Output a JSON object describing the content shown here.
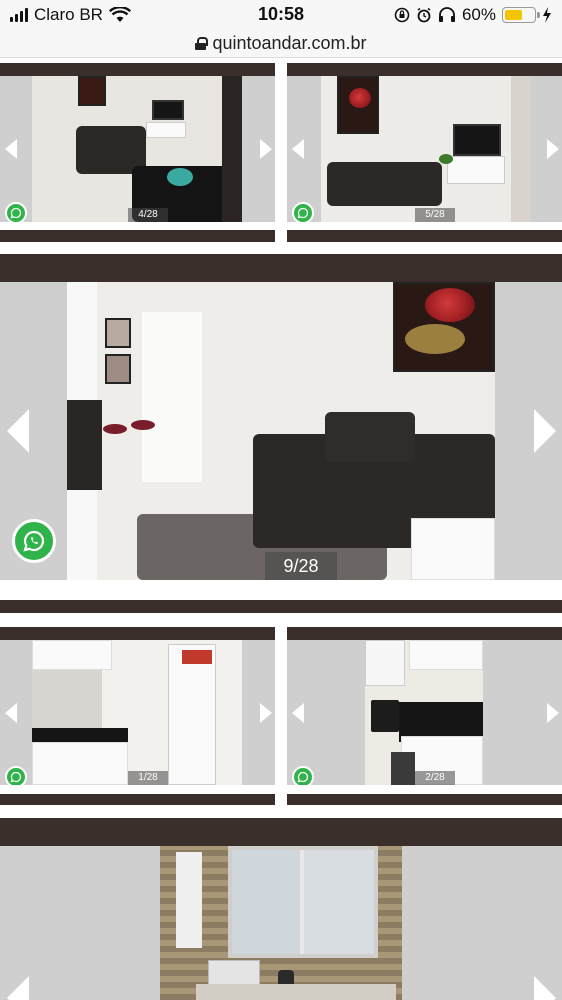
{
  "status_bar": {
    "carrier": "Claro BR",
    "time": "10:58",
    "battery_percent": "60%",
    "battery_level": 0.6
  },
  "url_bar": {
    "url": "quintoandar.com.br"
  },
  "gallery": {
    "row1": [
      {
        "counter": "4/28"
      },
      {
        "counter": "5/28"
      }
    ],
    "featured": {
      "counter": "9/28"
    },
    "row2": [
      {
        "counter": "1/28"
      },
      {
        "counter": "2/28"
      }
    ]
  },
  "colors": {
    "brand_dark": "#3a2f2a",
    "whatsapp_green": "#2fb34a",
    "battery_yellow": "#f5c400"
  }
}
